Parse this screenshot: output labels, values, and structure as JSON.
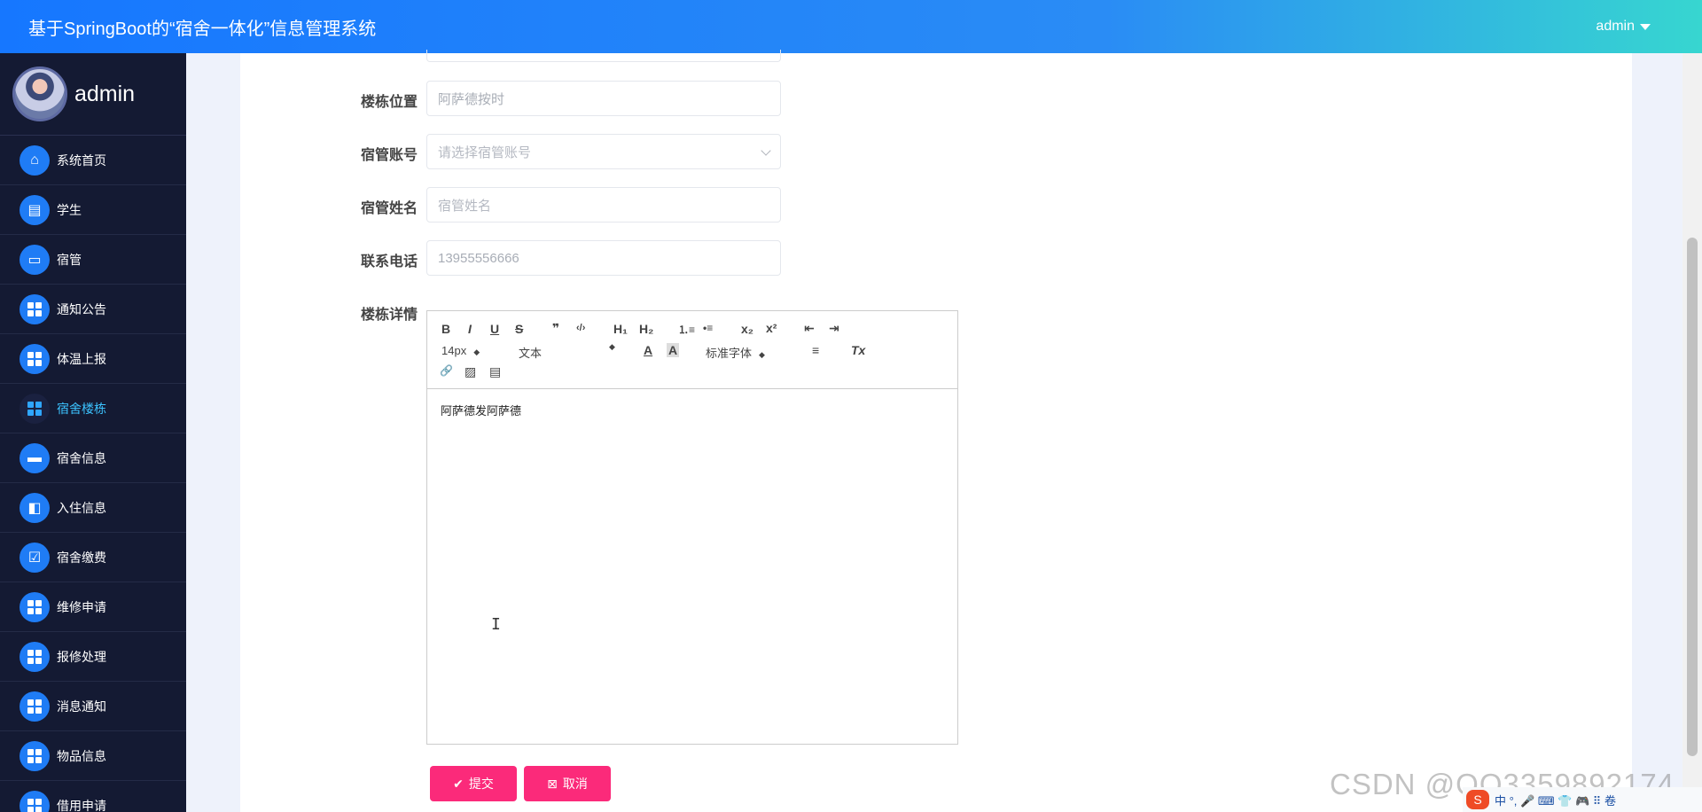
{
  "header": {
    "title": "基于SpringBoot的“宿舍一体化”信息管理系统",
    "user": "admin"
  },
  "sidebar": {
    "username": "admin",
    "items": [
      {
        "label": "系统首页",
        "icon": "home-icon"
      },
      {
        "label": "学生",
        "icon": "clipboard-icon"
      },
      {
        "label": "宿管",
        "icon": "monitor-icon"
      },
      {
        "label": "通知公告",
        "icon": "grid-icon"
      },
      {
        "label": "体温上报",
        "icon": "grid-icon"
      },
      {
        "label": "宿舍楼栋",
        "icon": "grid-icon",
        "active": true
      },
      {
        "label": "宿舍信息",
        "icon": "chat-icon"
      },
      {
        "label": "入住信息",
        "icon": "wallet-icon"
      },
      {
        "label": "宿舍缴费",
        "icon": "checklist-icon"
      },
      {
        "label": "维修申请",
        "icon": "grid-icon"
      },
      {
        "label": "报修处理",
        "icon": "grid-icon"
      },
      {
        "label": "消息通知",
        "icon": "grid-icon"
      },
      {
        "label": "物品信息",
        "icon": "grid-icon"
      },
      {
        "label": "借用申请",
        "icon": "grid-icon"
      }
    ]
  },
  "form": {
    "location_label": "楼栋位置",
    "location_value": "阿萨德按时",
    "manager_account_label": "宿管账号",
    "manager_account_placeholder": "请选择宿管账号",
    "manager_name_label": "宿管姓名",
    "manager_name_placeholder": "宿管姓名",
    "phone_label": "联系电话",
    "phone_value": "13955556666",
    "details_label": "楼栋详情"
  },
  "editor": {
    "toolbar": {
      "bold": "B",
      "italic": "I",
      "underline": "U",
      "strike": "S",
      "quote": "❞",
      "code": "‹/›",
      "h1": "H₁",
      "h2": "H₂",
      "ordered_list": "⒈≡",
      "bullet_list": "•≡",
      "subscript": "x₂",
      "superscript": "x²",
      "outdent": "⇤",
      "indent": "⇥",
      "font_size": "14px",
      "text_type": "文本",
      "font_color": "A",
      "bg_color": "A",
      "font_family": "标准字体",
      "align": "≡",
      "clear": "Tx",
      "link": "🔗",
      "image": "▨",
      "video": "▤"
    },
    "content": "阿萨德发阿萨德"
  },
  "buttons": {
    "submit": "提交",
    "cancel": "取消"
  },
  "watermark": "CSDN @QQ3359892174",
  "ime": {
    "logo": "S",
    "items": "中 °, 🎤 ⌨ 👕 🎮 ⠿ 卷"
  },
  "colors": {
    "header_start": "#1677ff",
    "header_end": "#37d6d0",
    "sidebar_bg": "#141a33",
    "active_item": "#3cc3ff",
    "button": "#fb2a7a"
  }
}
